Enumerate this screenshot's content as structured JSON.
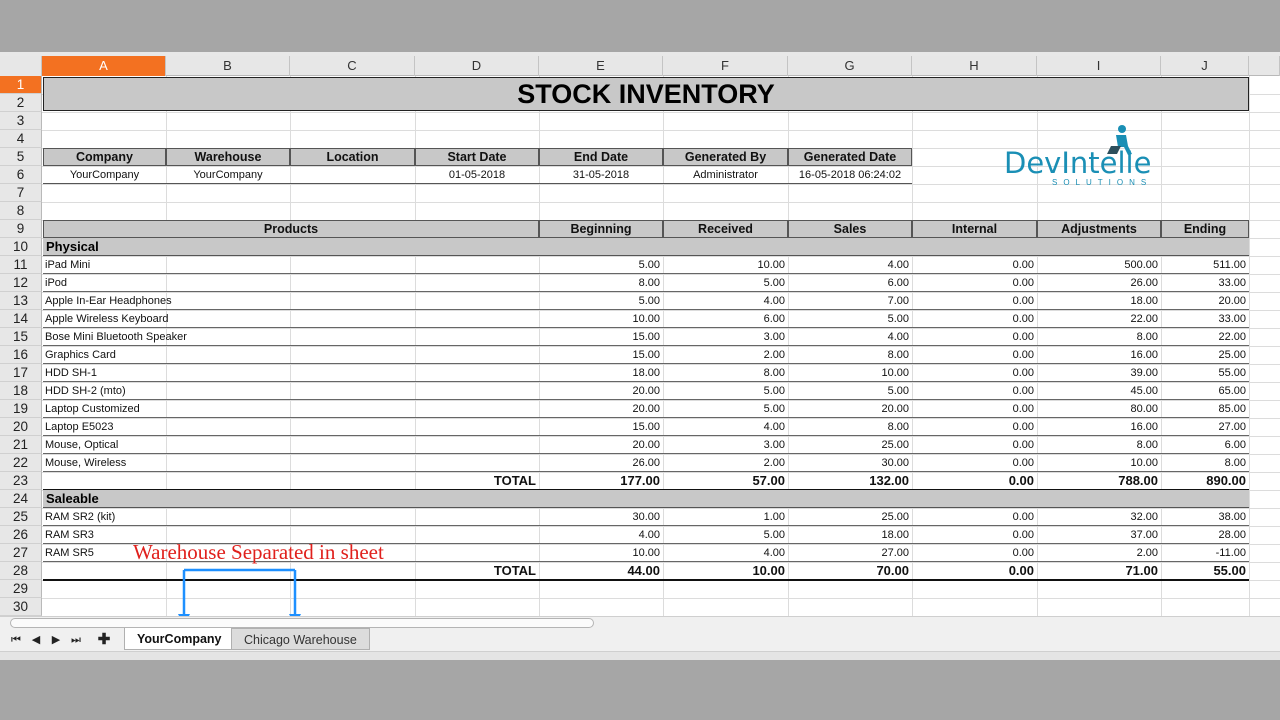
{
  "columns": [
    "A",
    "B",
    "C",
    "D",
    "E",
    "F",
    "G",
    "H",
    "I",
    "J"
  ],
  "rows": [
    "1",
    "2",
    "3",
    "4",
    "5",
    "6",
    "7",
    "8",
    "9",
    "10",
    "11",
    "12",
    "13",
    "14",
    "15",
    "16",
    "17",
    "18",
    "19",
    "20",
    "21",
    "22",
    "23",
    "24",
    "25",
    "26",
    "27",
    "28",
    "29",
    "30"
  ],
  "title": "STOCK INVENTORY",
  "info_headers": [
    "Company",
    "Warehouse",
    "Location",
    "Start Date",
    "End Date",
    "Generated By",
    "Generated Date"
  ],
  "info_values": [
    "YourCompany",
    "YourCompany",
    "",
    "01-05-2018",
    "31-05-2018",
    "Administrator",
    "16-05-2018 06:24:02"
  ],
  "table_headers": {
    "products": "Products",
    "beginning": "Beginning",
    "received": "Received",
    "sales": "Sales",
    "internal": "Internal",
    "adjustments": "Adjustments",
    "ending": "Ending"
  },
  "sections": [
    {
      "name": "Physical",
      "rows": [
        {
          "product": "iPad Mini",
          "beginning": "5.00",
          "received": "10.00",
          "sales": "4.00",
          "internal": "0.00",
          "adjustments": "500.00",
          "ending": "511.00"
        },
        {
          "product": "iPod",
          "beginning": "8.00",
          "received": "5.00",
          "sales": "6.00",
          "internal": "0.00",
          "adjustments": "26.00",
          "ending": "33.00"
        },
        {
          "product": "Apple In-Ear Headphones",
          "beginning": "5.00",
          "received": "4.00",
          "sales": "7.00",
          "internal": "0.00",
          "adjustments": "18.00",
          "ending": "20.00"
        },
        {
          "product": "Apple Wireless Keyboard",
          "beginning": "10.00",
          "received": "6.00",
          "sales": "5.00",
          "internal": "0.00",
          "adjustments": "22.00",
          "ending": "33.00"
        },
        {
          "product": "Bose Mini Bluetooth Speaker",
          "beginning": "15.00",
          "received": "3.00",
          "sales": "4.00",
          "internal": "0.00",
          "adjustments": "8.00",
          "ending": "22.00"
        },
        {
          "product": "Graphics Card",
          "beginning": "15.00",
          "received": "2.00",
          "sales": "8.00",
          "internal": "0.00",
          "adjustments": "16.00",
          "ending": "25.00"
        },
        {
          "product": "HDD SH-1",
          "beginning": "18.00",
          "received": "8.00",
          "sales": "10.00",
          "internal": "0.00",
          "adjustments": "39.00",
          "ending": "55.00"
        },
        {
          "product": "HDD SH-2 (mto)",
          "beginning": "20.00",
          "received": "5.00",
          "sales": "5.00",
          "internal": "0.00",
          "adjustments": "45.00",
          "ending": "65.00"
        },
        {
          "product": "Laptop Customized",
          "beginning": "20.00",
          "received": "5.00",
          "sales": "20.00",
          "internal": "0.00",
          "adjustments": "80.00",
          "ending": "85.00"
        },
        {
          "product": "Laptop E5023",
          "beginning": "15.00",
          "received": "4.00",
          "sales": "8.00",
          "internal": "0.00",
          "adjustments": "16.00",
          "ending": "27.00"
        },
        {
          "product": "Mouse, Optical",
          "beginning": "20.00",
          "received": "3.00",
          "sales": "25.00",
          "internal": "0.00",
          "adjustments": "8.00",
          "ending": "6.00"
        },
        {
          "product": "Mouse, Wireless",
          "beginning": "26.00",
          "received": "2.00",
          "sales": "30.00",
          "internal": "0.00",
          "adjustments": "10.00",
          "ending": "8.00"
        }
      ],
      "total": {
        "label": "TOTAL",
        "beginning": "177.00",
        "received": "57.00",
        "sales": "132.00",
        "internal": "0.00",
        "adjustments": "788.00",
        "ending": "890.00"
      }
    },
    {
      "name": "Saleable",
      "rows": [
        {
          "product": "RAM SR2 (kit)",
          "beginning": "30.00",
          "received": "1.00",
          "sales": "25.00",
          "internal": "0.00",
          "adjustments": "32.00",
          "ending": "38.00"
        },
        {
          "product": "RAM SR3",
          "beginning": "4.00",
          "received": "5.00",
          "sales": "18.00",
          "internal": "0.00",
          "adjustments": "37.00",
          "ending": "28.00"
        },
        {
          "product": "RAM SR5",
          "beginning": "10.00",
          "received": "4.00",
          "sales": "27.00",
          "internal": "0.00",
          "adjustments": "2.00",
          "ending": "-11.00"
        }
      ],
      "total": {
        "label": "TOTAL",
        "beginning": "44.00",
        "received": "10.00",
        "sales": "70.00",
        "internal": "0.00",
        "adjustments": "71.00",
        "ending": "55.00"
      }
    }
  ],
  "logo": {
    "text": "DevIntelle",
    "subtext": "SOLUTIONS",
    "color": "#1a8fb5"
  },
  "annotation": {
    "text": "Warehouse Separated in sheet",
    "color": "#e0201c",
    "arrow_color": "#1e90ff"
  },
  "tabs": [
    {
      "label": "YourCompany",
      "active": true
    },
    {
      "label": "Chicago Warehouse",
      "active": false
    }
  ],
  "accent_color": "#f37121"
}
